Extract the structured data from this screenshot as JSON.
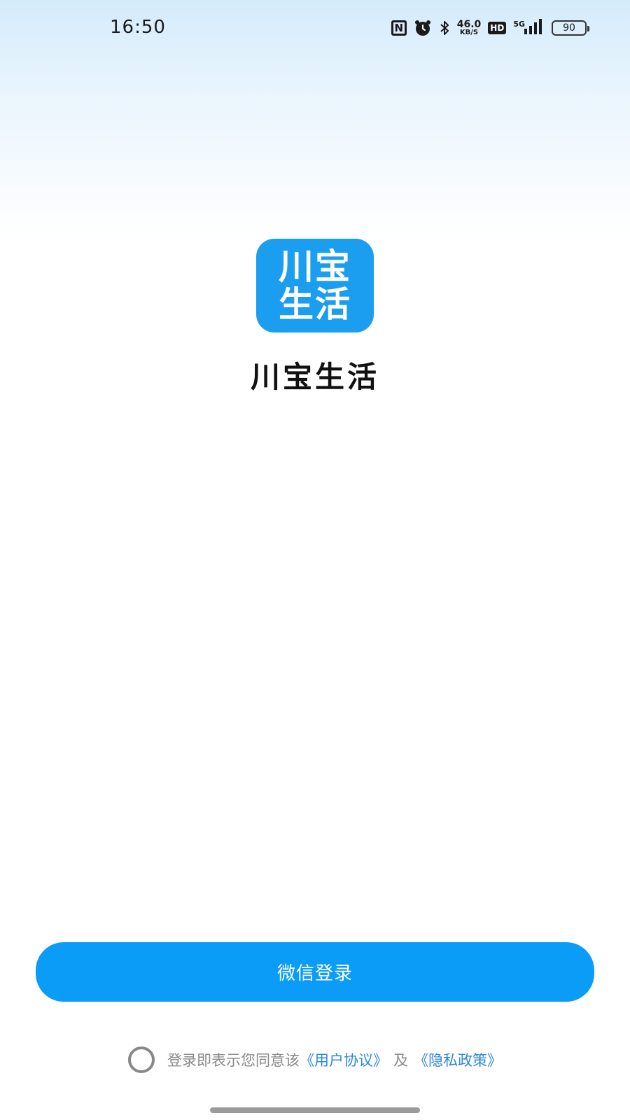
{
  "status_bar": {
    "time": "16:50",
    "net_speed_value": "46.0",
    "net_speed_unit": "KB/S",
    "hd_label": "HD",
    "network_type": "5G",
    "battery_level": "90",
    "icons": [
      "nfc-icon",
      "alarm-icon",
      "bluetooth-icon",
      "signal-icon",
      "battery-icon"
    ]
  },
  "app": {
    "logo_line1": "川宝",
    "logo_line2": "生活",
    "name": "川宝生活",
    "brand_color": "#1b9df0"
  },
  "login": {
    "button_label": "微信登录",
    "button_color": "#0b9cf7"
  },
  "agreement": {
    "checked": false,
    "prefix": "登录即表示您同意该",
    "user_agreement": "《用户协议》",
    "and": "及",
    "privacy_policy": "《隐私政策》",
    "link_color": "#2f87d8"
  }
}
